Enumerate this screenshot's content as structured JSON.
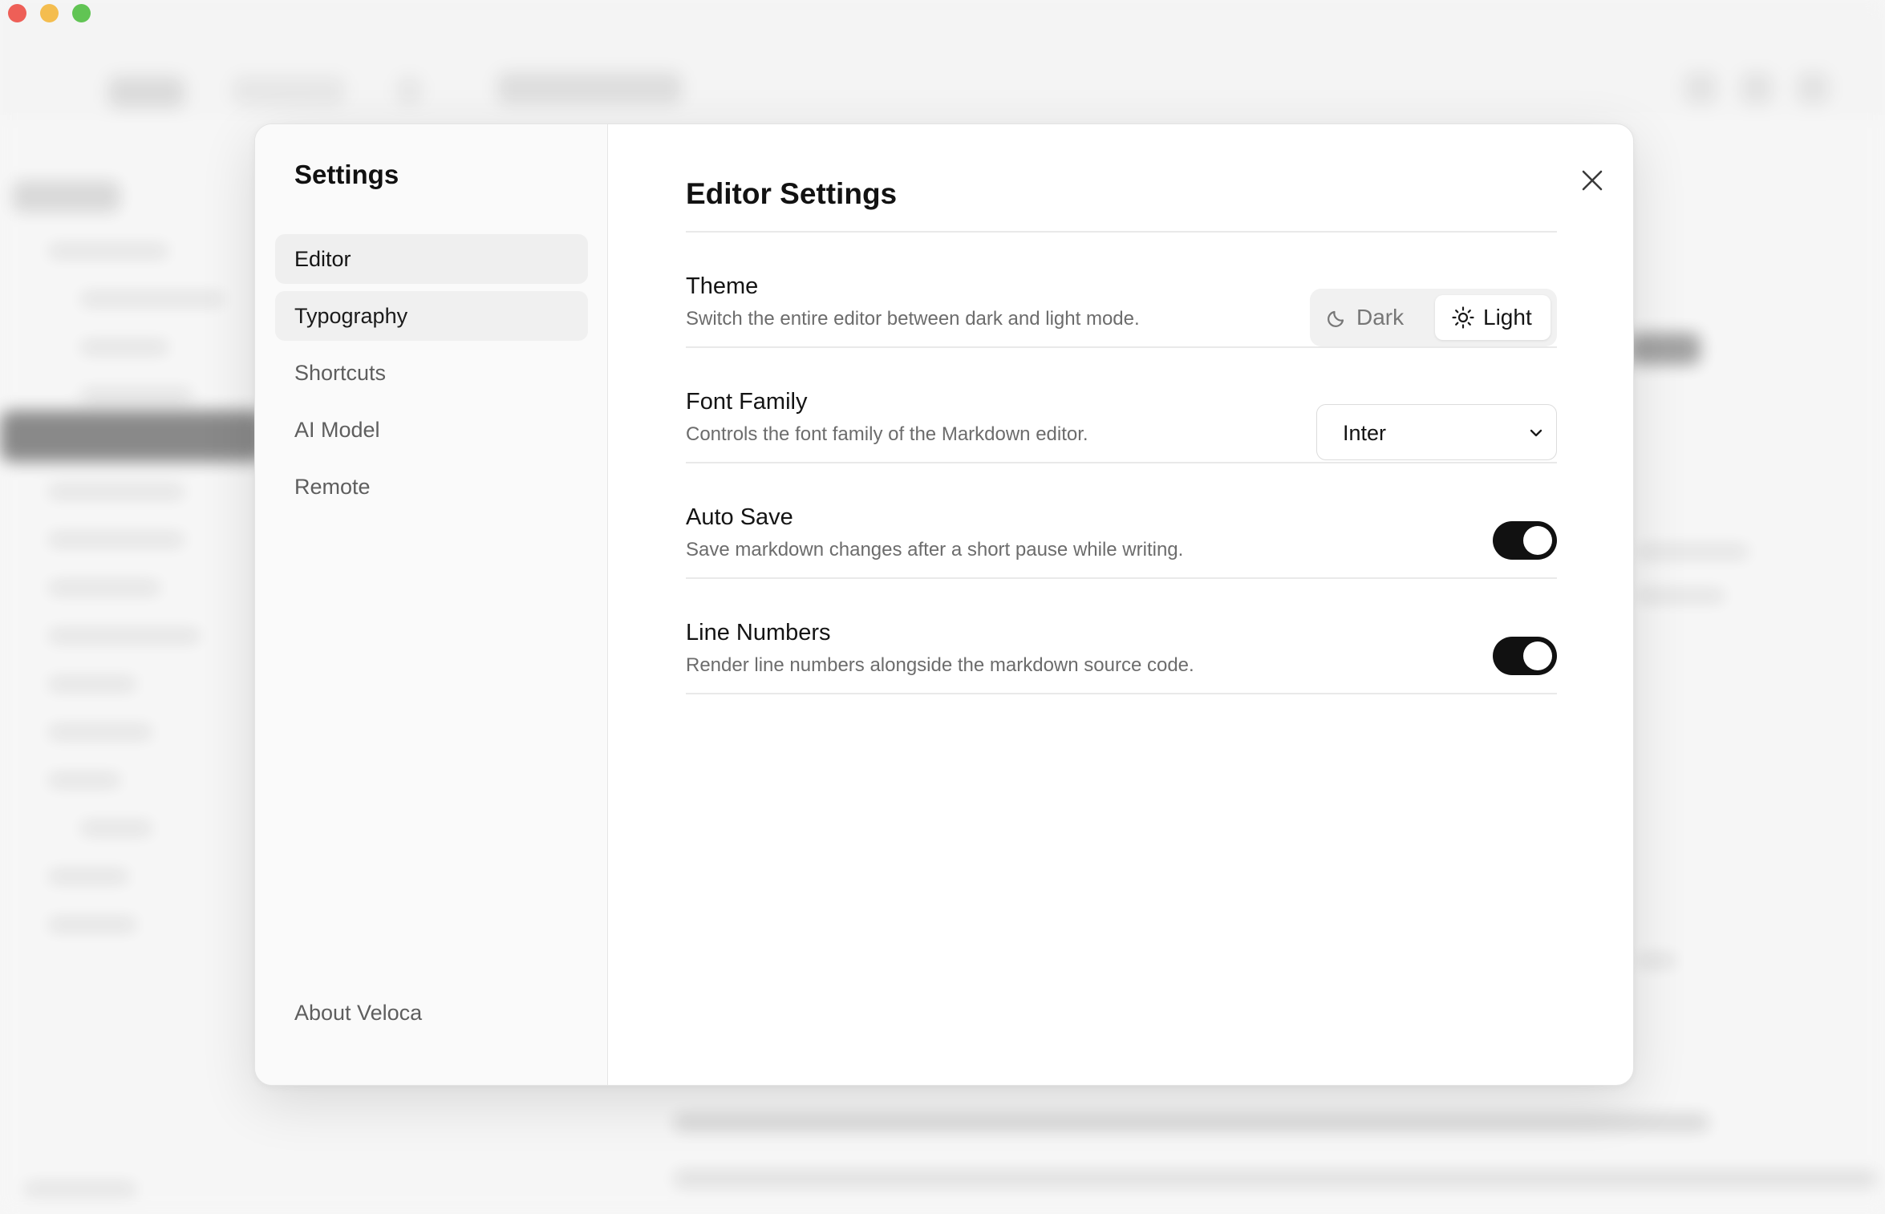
{
  "sidebar": {
    "title": "Settings",
    "items": [
      {
        "label": "Editor"
      },
      {
        "label": "Typography"
      },
      {
        "label": "Shortcuts"
      },
      {
        "label": "AI Model"
      },
      {
        "label": "Remote"
      }
    ],
    "active_item": "Editor",
    "footer_label": "About Veloca"
  },
  "main": {
    "title": "Editor Settings",
    "close_icon": "close-icon",
    "settings": [
      {
        "label": "Theme",
        "description": "Switch the entire editor between dark and light mode.",
        "control": "segmented",
        "options": [
          {
            "label": "Dark",
            "icon": "moon-icon"
          },
          {
            "label": "Light",
            "icon": "sun-icon"
          }
        ],
        "selected": "Light"
      },
      {
        "label": "Font Family",
        "description": "Controls the font family of the Markdown editor.",
        "control": "select",
        "value": "Inter"
      },
      {
        "label": "Auto Save",
        "description": "Save markdown changes after a short pause while writing.",
        "control": "toggle",
        "enabled": true
      },
      {
        "label": "Line Numbers",
        "description": "Render line numbers alongside the markdown source code.",
        "control": "toggle",
        "enabled": true
      }
    ]
  },
  "colors": {
    "accent_toggle": "#111111",
    "traffic_red": "#ee5f57",
    "traffic_yellow": "#f4bd4f",
    "traffic_green": "#61c454"
  }
}
